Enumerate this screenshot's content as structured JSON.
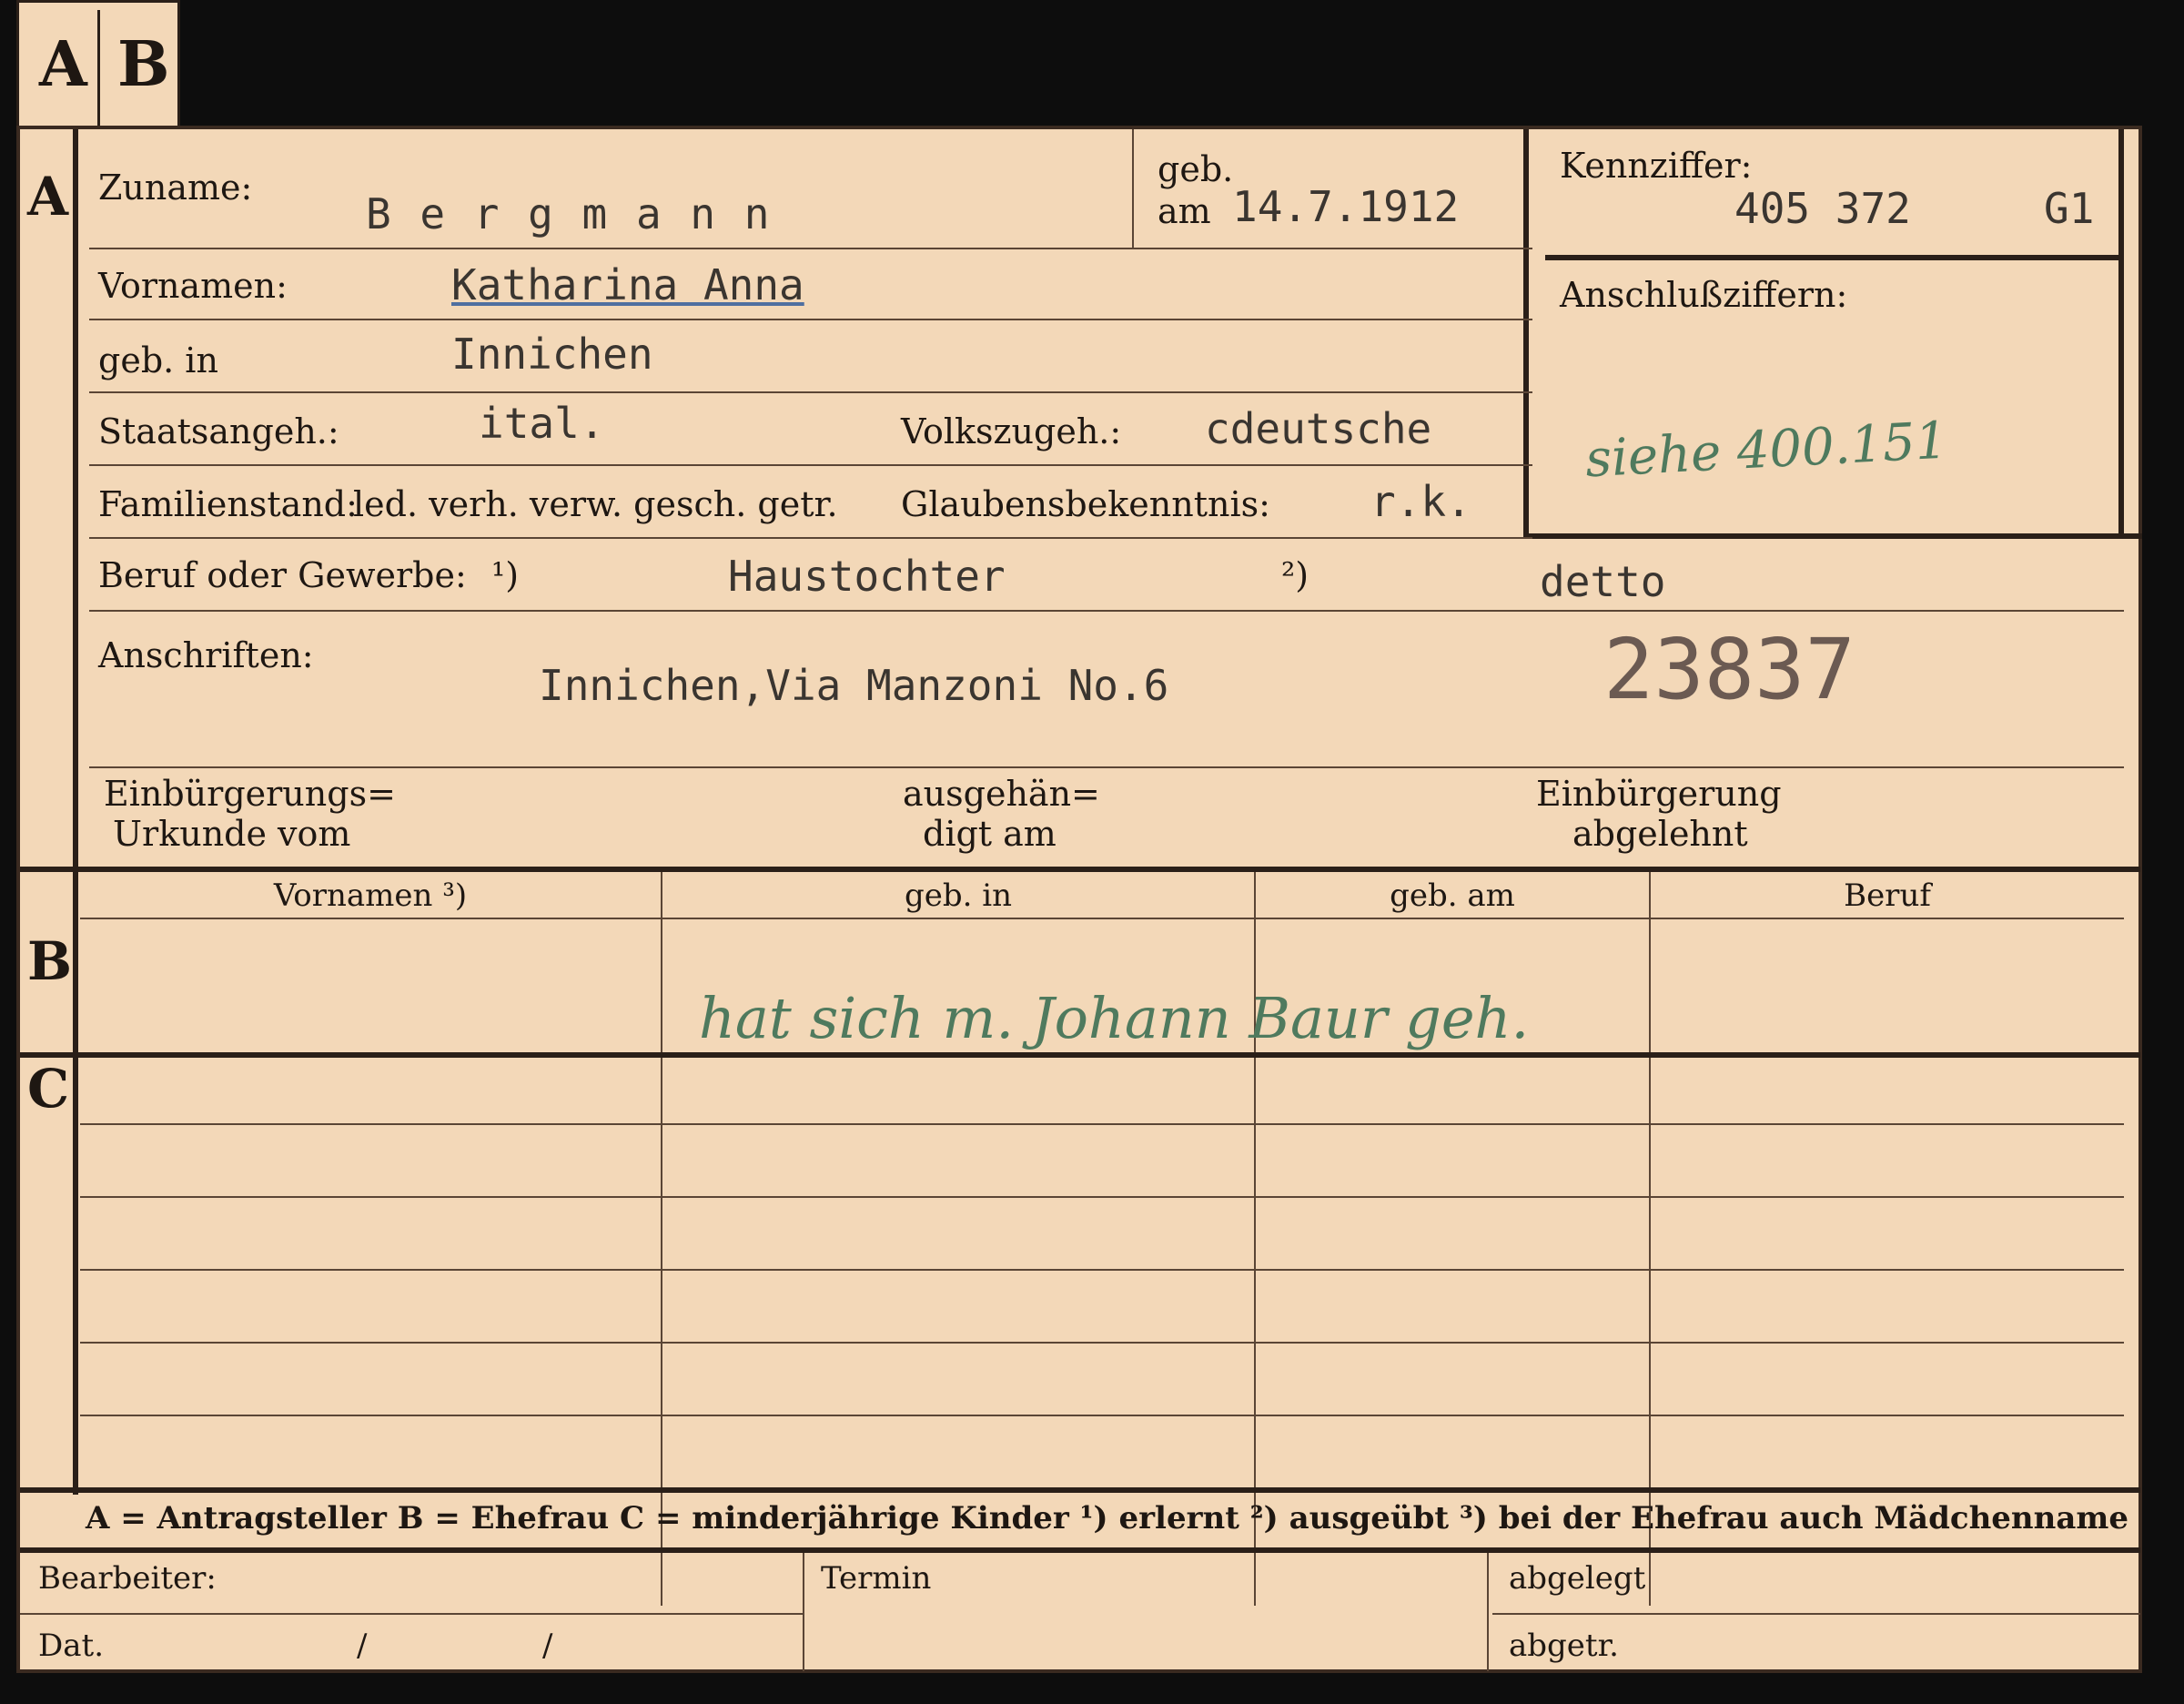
{
  "tab": {
    "a": "A",
    "b": "B"
  },
  "section": {
    "a": "A",
    "b": "B",
    "c": "C"
  },
  "fields": {
    "zuname_label": "Zuname:",
    "zuname_value": "B e r g m a n n",
    "geb_label": "geb.",
    "am_label": "am",
    "geb_am_value": "14.7.1912",
    "kennziffer_label": "Kennziffer:",
    "kennziffer_value": "405 372",
    "kennziffer_suffix": "G1",
    "anschluss_label": "Anschlußziffern:",
    "anschluss_note": "siehe 400.151",
    "vornamen_label": "Vornamen:",
    "vornamen_value": "Katharina Anna",
    "gebin_label": "geb. in",
    "gebin_value": "Innichen",
    "staat_label": "Staatsangeh.:",
    "staat_value": "ital.",
    "volks_label": "Volkszugeh.:",
    "volks_value": "cdeutsche",
    "familien_label": "Familienstand:",
    "familien_options": "led. verh. verw. gesch. getr.",
    "glauben_label": "Glaubensbekenntnis:",
    "glauben_value": "r.k.",
    "beruf_label": "Beruf oder Gewerbe:",
    "beruf_mark1": "¹)",
    "beruf_value": "Haustochter",
    "beruf_mark2": "²)",
    "beruf_value2": "detto",
    "anschriften_label": "Anschriften:",
    "anschriften_value": "Innichen,Via Manzoni No.6",
    "stamp_number": "23837",
    "einb_urkunde": [
      "Einbürgerungs=",
      "Urkunde vom"
    ],
    "ausgehaen": [
      "ausgehän=",
      "digt am"
    ],
    "einb_abgelehnt": [
      "Einbürgerung",
      "abgelehnt"
    ]
  },
  "table": {
    "headers": [
      "Vornamen ³)",
      "geb. in",
      "geb. am",
      "Beruf"
    ],
    "handwritten_note": "hat sich m. Johann Baur geh."
  },
  "legend": "A = Antragsteller   B = Ehefrau   C = minderjährige Kinder   ¹) erlernt   ²) ausgeübt   ³) bei der Ehefrau auch Mädchenname",
  "footer": {
    "bearbeiter": "Bearbeiter:",
    "dat": "Dat.",
    "slash1": "/",
    "slash2": "/",
    "termin": "Termin",
    "abgelegt": "abgelegt",
    "abgetr": "abgetr."
  },
  "colors": {
    "card": "#f3d8b8",
    "ink": "#1e1712",
    "typewriter": "#3a3530",
    "pencil_green": "#4f7a5e",
    "background": "#0d0d0d"
  }
}
